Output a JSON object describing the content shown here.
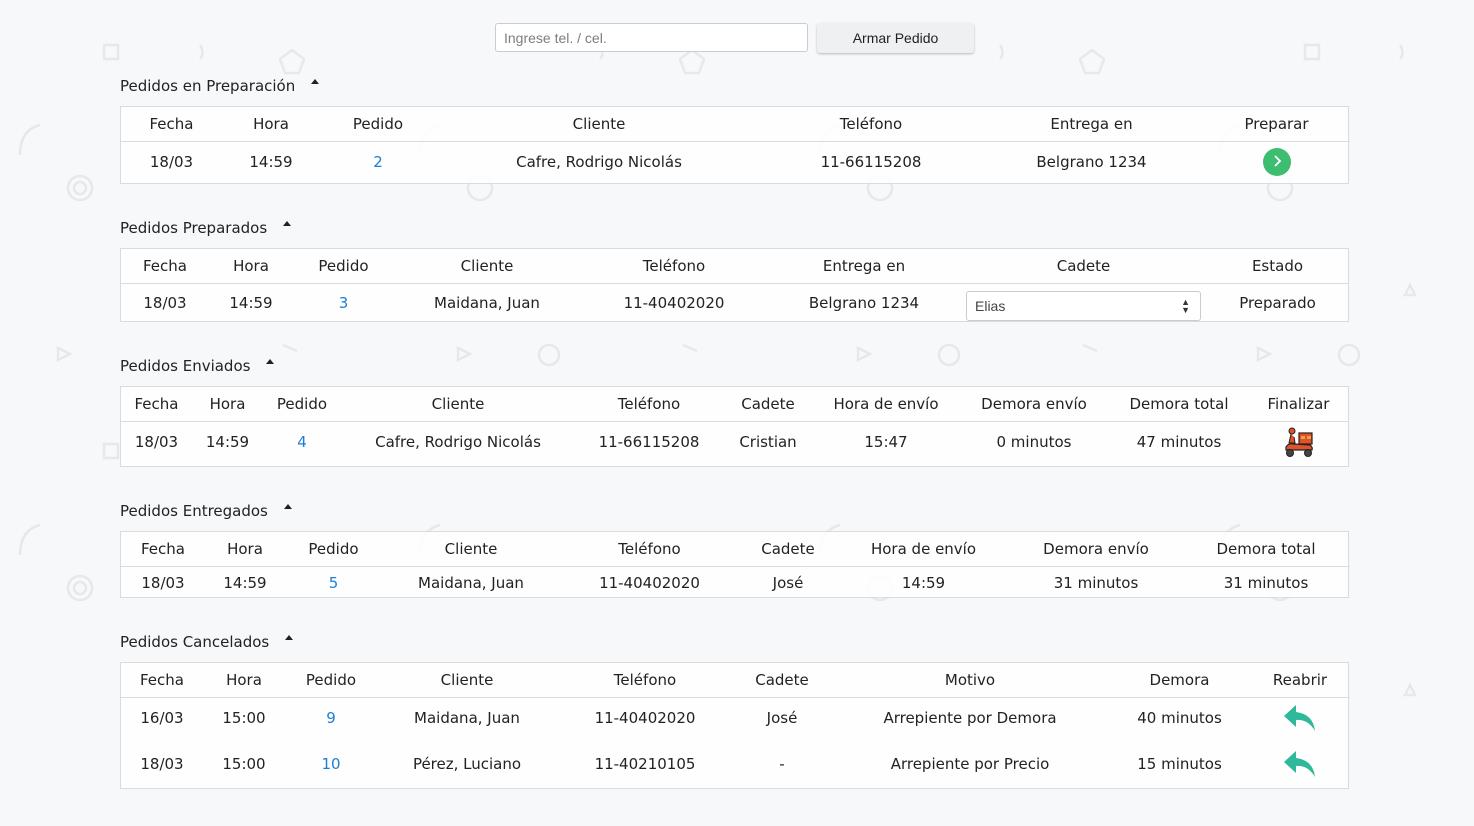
{
  "search": {
    "placeholder": "Ingrese tel. / cel.",
    "value": ""
  },
  "armar_pedido_label": "Armar Pedido",
  "colors": {
    "link": "#1b7fd6",
    "go_button": "#3dbd70",
    "reopen_icon": "#2fb89a",
    "scooter": "#e0522a"
  },
  "en_preparacion": {
    "title": "Pedidos en Preparación",
    "headers": [
      "Fecha",
      "Hora",
      "Pedido",
      "Cliente",
      "Teléfono",
      "Entrega en",
      "Preparar"
    ],
    "rows": [
      {
        "fecha": "18/03",
        "hora": "14:59",
        "pedido": "2",
        "cliente": "Cafre, Rodrigo Nicolás",
        "telefono": "11-66115208",
        "entrega": "Belgrano 1234",
        "action_icon": "chevron-right-icon"
      }
    ]
  },
  "preparados": {
    "title": "Pedidos Preparados",
    "headers": [
      "Fecha",
      "Hora",
      "Pedido",
      "Cliente",
      "Teléfono",
      "Entrega en",
      "Cadete",
      "Estado"
    ],
    "rows": [
      {
        "fecha": "18/03",
        "hora": "14:59",
        "pedido": "3",
        "cliente": "Maidana, Juan",
        "telefono": "11-40402020",
        "entrega": "Belgrano 1234",
        "cadete": "Elias",
        "estado": "Preparado"
      }
    ]
  },
  "enviados": {
    "title": "Pedidos Enviados",
    "headers": [
      "Fecha",
      "Hora",
      "Pedido",
      "Cliente",
      "Teléfono",
      "Cadete",
      "Hora de envío",
      "Demora envío",
      "Demora total",
      "Finalizar"
    ],
    "rows": [
      {
        "fecha": "18/03",
        "hora": "14:59",
        "pedido": "4",
        "cliente": "Cafre, Rodrigo Nicolás",
        "telefono": "11-66115208",
        "cadete": "Cristian",
        "hora_envio": "15:47",
        "demora_envio": "0 minutos",
        "demora_total": "47 minutos",
        "action_icon": "delivery-scooter-icon"
      }
    ]
  },
  "entregados": {
    "title": "Pedidos Entregados",
    "headers": [
      "Fecha",
      "Hora",
      "Pedido",
      "Cliente",
      "Teléfono",
      "Cadete",
      "Hora de envío",
      "Demora envío",
      "Demora total"
    ],
    "rows": [
      {
        "fecha": "18/03",
        "hora": "14:59",
        "pedido": "5",
        "cliente": "Maidana, Juan",
        "telefono": "11-40402020",
        "cadete": "José",
        "hora_envio": "14:59",
        "demora_envio": "31 minutos",
        "demora_total": "31 minutos"
      }
    ]
  },
  "cancelados": {
    "title": "Pedidos Cancelados",
    "headers": [
      "Fecha",
      "Hora",
      "Pedido",
      "Cliente",
      "Teléfono",
      "Cadete",
      "Motivo",
      "Demora",
      "Reabrir"
    ],
    "rows": [
      {
        "fecha": "16/03",
        "hora": "15:00",
        "pedido": "9",
        "cliente": "Maidana, Juan",
        "telefono": "11-40402020",
        "cadete": "José",
        "motivo": "Arrepiente por Demora",
        "demora": "40 minutos",
        "action_icon": "reply-icon"
      },
      {
        "fecha": "18/03",
        "hora": "15:00",
        "pedido": "10",
        "cliente": "Pérez, Luciano",
        "telefono": "11-40210105",
        "cadete": "-",
        "motivo": "Arrepiente por Precio",
        "demora": "15 minutos",
        "action_icon": "reply-icon"
      }
    ]
  }
}
